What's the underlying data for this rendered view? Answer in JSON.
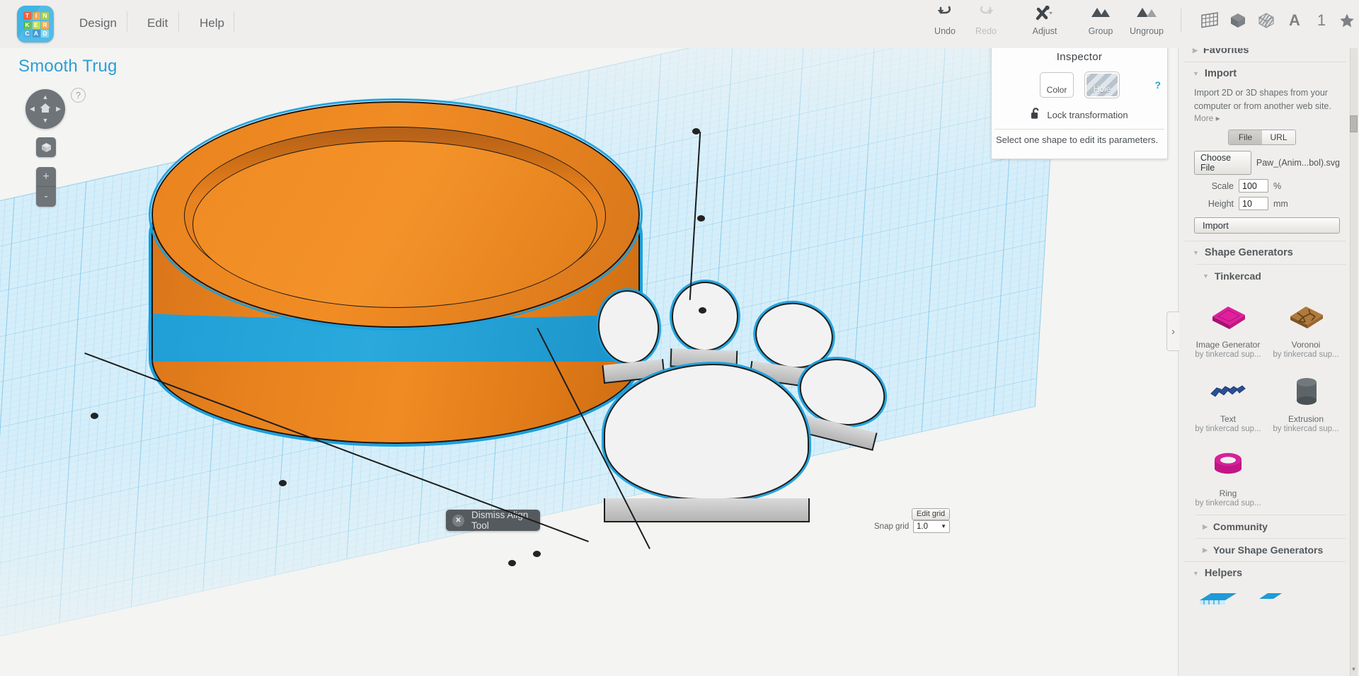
{
  "app": {
    "logo_tiles": [
      {
        "letter": "T",
        "color": "#f0603c"
      },
      {
        "letter": "I",
        "color": "#f3a23a"
      },
      {
        "letter": "N",
        "color": "#9ccb3b"
      },
      {
        "letter": "K",
        "color": "#53b848"
      },
      {
        "letter": "E",
        "color": "#c2d92e"
      },
      {
        "letter": "R",
        "color": "#f3a23a"
      },
      {
        "letter": "C",
        "color": "#3ca9e0"
      },
      {
        "letter": "A",
        "color": "#2f8fd4"
      },
      {
        "letter": "D",
        "color": "#7fd3f0"
      }
    ],
    "logo_bg": "#3fb4e5"
  },
  "menu": [
    {
      "label": "Design"
    },
    {
      "label": "Edit"
    },
    {
      "label": "Help"
    }
  ],
  "toolbar": [
    {
      "label": "Undo",
      "icon": "undo-icon",
      "disabled": false
    },
    {
      "label": "Redo",
      "icon": "redo-icon",
      "disabled": true
    },
    {
      "label": "Adjust",
      "icon": "adjust-icon",
      "disabled": false
    },
    {
      "label": "Group",
      "icon": "group-icon",
      "disabled": false
    },
    {
      "label": "Ungroup",
      "icon": "ungroup-icon",
      "disabled": false
    }
  ],
  "right_icons": [
    {
      "name": "workplane-grid-icon",
      "glyph": "grid"
    },
    {
      "name": "solid-cube-icon",
      "glyph": "cube"
    },
    {
      "name": "hole-cube-icon",
      "glyph": "striped-cube"
    },
    {
      "name": "text-tool-icon",
      "glyph": "A"
    },
    {
      "name": "number-tool-icon",
      "glyph": "1"
    },
    {
      "name": "favorites-star-icon",
      "glyph": "star"
    }
  ],
  "canvas": {
    "project_title": "Smooth Trug",
    "nav": {
      "home_icon": "home-icon",
      "help_icon": "question-mark-icon",
      "cube_icon": "view-cube-icon",
      "zoom_in": "+",
      "zoom_out": "-"
    },
    "dismiss_align": {
      "label": "Dismiss Align Tool",
      "close_icon": "close-x-icon"
    },
    "edit_grid_label": "Edit grid",
    "snap_grid_label": "Snap grid",
    "snap_grid_value": "1.0",
    "shapes": [
      {
        "name": "trug-bowl",
        "color": "#ef8b22",
        "accent": "#1f9fd6",
        "selected": true
      },
      {
        "name": "paw-print",
        "color": "#f2f2f2",
        "selected": true
      }
    ],
    "selection_color": "#1ba0dd",
    "workplane_color": "#d5eefa"
  },
  "inspector": {
    "title": "Inspector",
    "color_label": "Color",
    "hole_label": "Hole",
    "help_label": "?",
    "lock_label": "Lock transformation",
    "lock_icon": "open-lock-icon",
    "message": "Select one shape to edit its parameters."
  },
  "sidebar": {
    "favorites": {
      "label": "Favorites",
      "expanded": false
    },
    "import": {
      "label": "Import",
      "expanded": true,
      "description": "Import 2D or 3D shapes from your computer or from another web site.",
      "more_label": "More ▸",
      "source_tabs": [
        "File",
        "URL"
      ],
      "active_source_tab": "File",
      "choose_file_label": "Choose File",
      "chosen_file_name": "Paw_(Anim...bol).svg",
      "scale_label": "Scale",
      "scale_value": "100",
      "scale_unit": "%",
      "height_label": "Height",
      "height_value": "10",
      "height_unit": "mm",
      "import_button_label": "Import"
    },
    "shape_generators": {
      "label": "Shape Generators",
      "expanded": true,
      "tinkercad": {
        "label": "Tinkercad",
        "expanded": true,
        "items": [
          {
            "name": "Image Generator",
            "author": "by tinkercad sup...",
            "color": "#d6118f",
            "shape": "slab"
          },
          {
            "name": "Voronoi",
            "author": "by tinkercad sup...",
            "color": "#a06a32",
            "shape": "voronoi"
          },
          {
            "name": "Text",
            "author": "by tinkercad sup...",
            "color": "#2a4f96",
            "shape": "text"
          },
          {
            "name": "Extrusion",
            "author": "by tinkercad sup...",
            "color": "#5d6468",
            "shape": "cylinder"
          },
          {
            "name": "Ring",
            "author": "by tinkercad sup...",
            "color": "#c21687",
            "shape": "ring"
          }
        ]
      },
      "community": {
        "label": "Community",
        "expanded": false
      },
      "your_generators": {
        "label": "Your Shape Generators",
        "expanded": false
      }
    },
    "helpers": {
      "label": "Helpers",
      "expanded": true
    }
  },
  "collapse_handle": {
    "icon": "chevron-right-icon",
    "glyph": "›"
  }
}
